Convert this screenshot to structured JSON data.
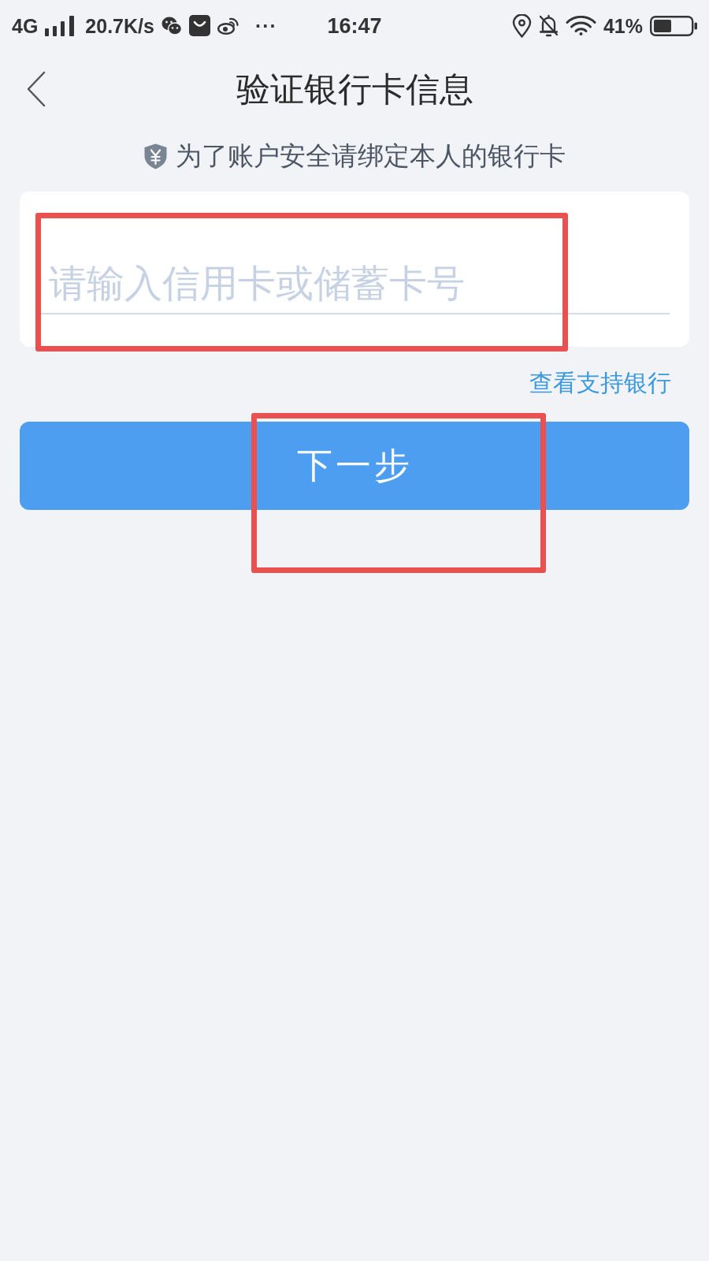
{
  "status_bar": {
    "network": "4G",
    "speed": "20.7K/s",
    "more": "···",
    "time": "16:47",
    "battery": "41%"
  },
  "nav": {
    "title": "验证银行卡信息"
  },
  "notice": "为了账户安全请绑定本人的银行卡",
  "card_field": {
    "placeholder": "请输入信用卡或储蓄卡号",
    "highlighted": true
  },
  "bank_link": "查看支持银行",
  "next_button": {
    "label": "下一步",
    "highlighted": true
  }
}
